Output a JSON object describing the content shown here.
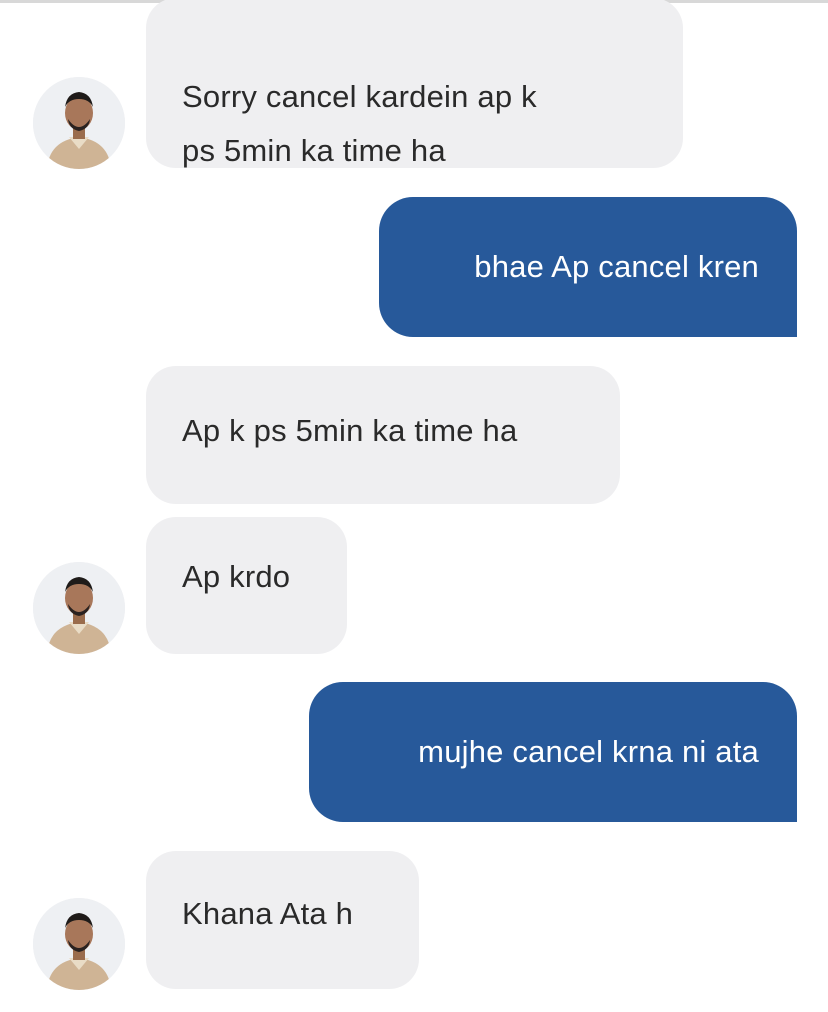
{
  "chat": {
    "messages": [
      {
        "sender": "other",
        "text": "Sorry cancel kardein ap k\nps 5min ka time ha"
      },
      {
        "sender": "me",
        "text": "bhae Ap cancel kren"
      },
      {
        "sender": "other",
        "text": "Ap k ps 5min ka time ha"
      },
      {
        "sender": "other",
        "text": "Ap krdo"
      },
      {
        "sender": "me",
        "text": "mujhe cancel krna ni ata"
      },
      {
        "sender": "other",
        "text": "Khana Ata h"
      }
    ]
  },
  "colors": {
    "outgoing_bubble": "#27599a",
    "incoming_bubble": "#efeff1",
    "incoming_text": "#2a2a2a",
    "outgoing_text": "#ffffff"
  },
  "icons": {
    "avatar": "user-photo-avatar"
  }
}
